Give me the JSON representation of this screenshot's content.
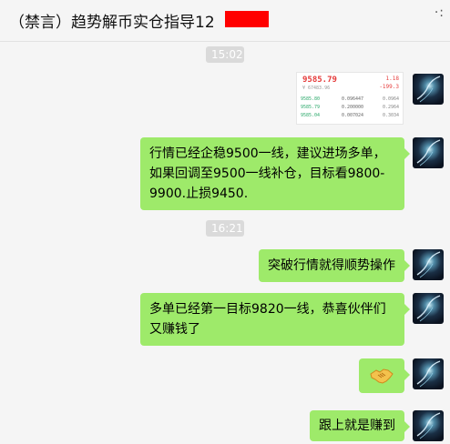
{
  "header": {
    "title": "（禁言）趋势解币实仓指导12",
    "more_icon": "more-dots-icon"
  },
  "timestamps": [
    "15:02",
    "16:21"
  ],
  "image_message": {
    "price": "9585.79",
    "change_top": "1.18",
    "sub_line": "¥ 67483.96",
    "change_bottom": "-199.3",
    "rows": [
      [
        "9585.80",
        "0.096447",
        "0.0964"
      ],
      [
        "9585.79",
        "0.200000",
        "0.2964"
      ],
      [
        "9585.04",
        "0.007024",
        "0.3034"
      ]
    ]
  },
  "messages": [
    {
      "text": "行情已经企稳9500一线，建议进场多单，如果回调至9500一线补仓，目标看9800-9900.止损9450."
    },
    {
      "text": "突破行情就得顺势操作"
    },
    {
      "text": "多单已经第一目标9820一线，恭喜伙伴们又赚钱了"
    },
    {
      "emoji": "handshake-emoji"
    },
    {
      "text": "跟上就是赚到"
    }
  ],
  "colors": {
    "bubble_green": "#9eea6a",
    "background": "#f5f5f5",
    "redaction": "#ff0000"
  }
}
